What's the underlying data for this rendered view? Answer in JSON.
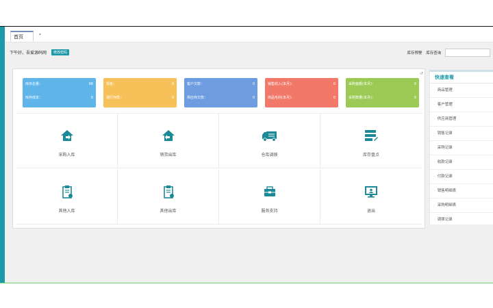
{
  "tabs": [
    {
      "label": "首页"
    }
  ],
  "welcome": {
    "greeting": "下午好，吾爱源码网",
    "badge": "修改密码"
  },
  "stock_tools": {
    "warning_label": "库存预警",
    "query_label": "库存查询",
    "query_value": ""
  },
  "colors": {
    "teal": "#1c9aa8",
    "blue": "#5fb5ea",
    "yellow": "#f7c15a",
    "slate_blue": "#6d9de0",
    "red": "#f2786a",
    "green": "#9bcb56"
  },
  "stats": [
    {
      "color": "blue",
      "rows": [
        {
          "label": "库存总量：",
          "value": "98"
        },
        {
          "label": "库存成本：",
          "value": "0"
        }
      ]
    },
    {
      "color": "yellow",
      "rows": [
        {
          "label": "现金：",
          "value": "0"
        },
        {
          "label": "银行存款：",
          "value": "0"
        }
      ]
    },
    {
      "color": "slate_blue",
      "rows": [
        {
          "label": "客户欠款：",
          "value": "0"
        },
        {
          "label": "供应商欠款：",
          "value": "0"
        }
      ]
    },
    {
      "color": "red",
      "rows": [
        {
          "label": "销售收入(本月)：",
          "value": "0"
        },
        {
          "label": "商品毛利(本月)：",
          "value": "0"
        }
      ]
    },
    {
      "color": "green",
      "rows": [
        {
          "label": "采购金额(本月)：",
          "value": "0"
        },
        {
          "label": "采购数量(本月)：",
          "value": "0"
        }
      ]
    }
  ],
  "actions": [
    {
      "label": "采购入库",
      "icon": "house-in-icon"
    },
    {
      "label": "销货出库",
      "icon": "house-out-icon"
    },
    {
      "label": "仓库调拨",
      "icon": "truck-icon"
    },
    {
      "label": "库存盘点",
      "icon": "inventory-icon"
    },
    {
      "label": "其他入库",
      "icon": "clipboard-in-icon"
    },
    {
      "label": "其他出库",
      "icon": "clipboard-out-icon"
    },
    {
      "label": "服务支持",
      "icon": "service-icon"
    },
    {
      "label": "退出",
      "icon": "monitor-icon"
    }
  ],
  "quick_view": {
    "title": "快速查看",
    "items": [
      "商品管理",
      "客户管理",
      "供应商管理",
      "销售记录",
      "采购记录",
      "收款记录",
      "付款记录",
      "销售明细表",
      "采购明细表",
      "调拨记录"
    ]
  }
}
